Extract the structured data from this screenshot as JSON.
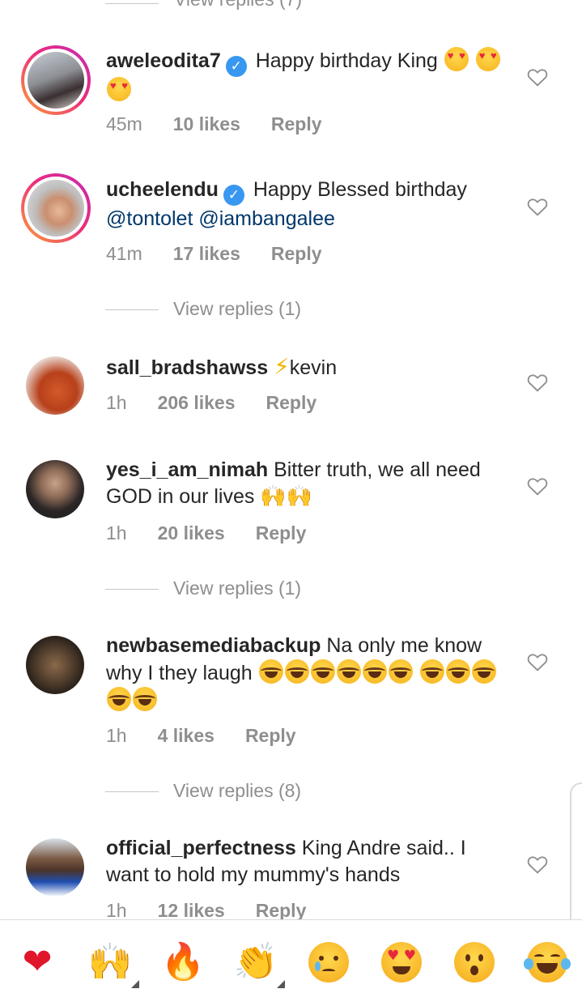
{
  "top_partial": {
    "label": "View replies (7)"
  },
  "comments": [
    {
      "username": "aweleodita7",
      "verified": true,
      "text": "Happy birthday King",
      "text_mentions": "",
      "time": "45m",
      "likes": "10 likes",
      "reply": "Reply",
      "view_replies": ""
    },
    {
      "username": "ucheelendu",
      "verified": true,
      "text": "Happy Blessed birthday",
      "text_mentions": "@tontolet @iambangalee",
      "time": "41m",
      "likes": "17 likes",
      "reply": "Reply",
      "view_replies": "View replies (1)"
    },
    {
      "username": "sall_bradshawss",
      "verified": false,
      "text": "kevin",
      "text_mentions": "",
      "time": "1h",
      "likes": "206 likes",
      "reply": "Reply",
      "view_replies": ""
    },
    {
      "username": "yes_i_am_nimah",
      "verified": false,
      "text": "Bitter truth, we all need GOD in our lives",
      "text_mentions": "",
      "time": "1h",
      "likes": "20 likes",
      "reply": "Reply",
      "view_replies": "View replies (1)"
    },
    {
      "username": "newbasemediabackup",
      "verified": false,
      "text": "Na only me know why I they laugh",
      "text_mentions": "",
      "time": "1h",
      "likes": "4 likes",
      "reply": "Reply",
      "view_replies": "View replies (8)"
    },
    {
      "username": "official_perfectness",
      "verified": false,
      "text": "King Andre said.. I want to hold my mummy's hands",
      "text_mentions": "",
      "time": "1h",
      "likes": "12 likes",
      "reply": "Reply",
      "view_replies": ""
    }
  ],
  "quick_emojis": [
    "heart",
    "raising-hands",
    "fire",
    "clapping-hands",
    "crying-face",
    "heart-eyes-face",
    "surprised-face",
    "tears-of-joy-face"
  ],
  "icons": {
    "like": "heart-outline-icon",
    "verified": "verified-badge-icon"
  },
  "colors": {
    "text": "#262626",
    "muted": "#8e8e8e",
    "mention": "#00376b",
    "verified": "#3897f0"
  }
}
